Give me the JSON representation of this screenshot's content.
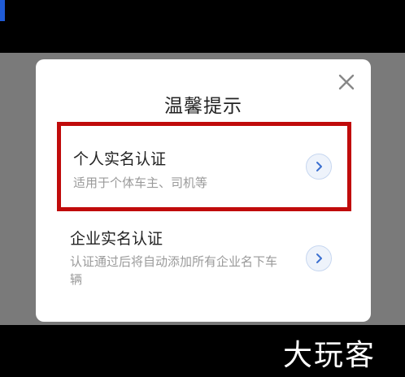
{
  "dialog": {
    "title": "温馨提示",
    "close_icon": "close-icon"
  },
  "options": [
    {
      "title": "个人实名认证",
      "description": "适用于个体车主、司机等",
      "icon": "chevron-right-icon",
      "highlight_color": "#c00b0b"
    },
    {
      "title": "企业实名认证",
      "description": "认证通过后将自动添加所有企业名下车辆",
      "icon": "chevron-right-icon"
    }
  ],
  "watermark": "大玩客",
  "colors": {
    "accent": "#3b6fd0",
    "highlight": "#c00b0b"
  }
}
